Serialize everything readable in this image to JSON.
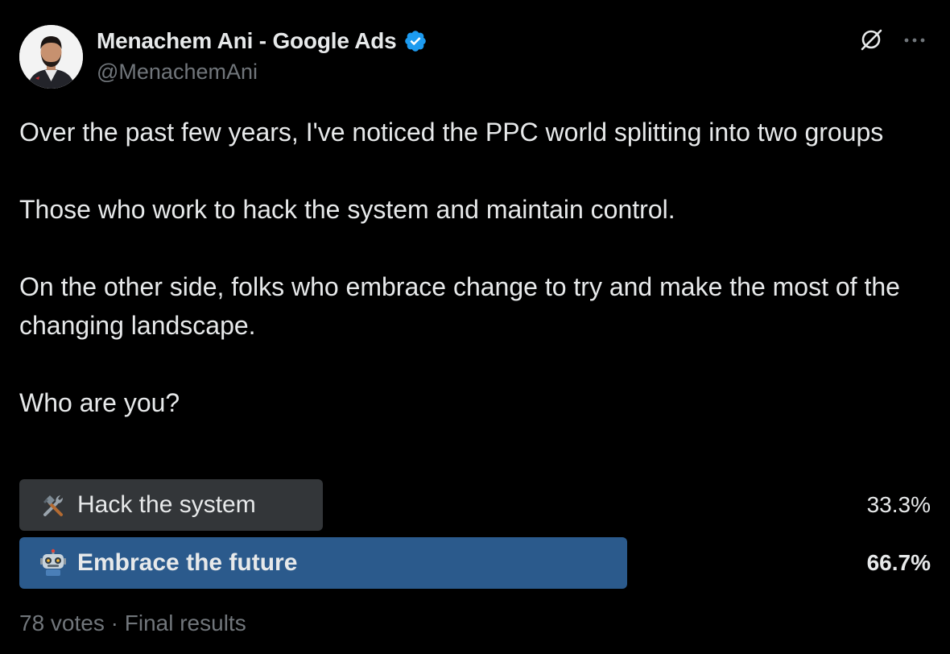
{
  "author": {
    "name": "Menachem Ani - Google Ads",
    "handle": "@MenachemAni",
    "verified": true,
    "verified_color": "#1d9bf0"
  },
  "header_actions": {
    "grok_icon": "grok-icon",
    "more_icon": "more-horizontal-icon"
  },
  "tweet": {
    "paragraphs": [
      "Over the past few years, I've noticed the PPC world splitting into two groups",
      "Those who work to hack the system and maintain control.",
      "On the other side, folks who embrace change to try and make the most of the changing landscape.",
      "Who are you?"
    ]
  },
  "poll": {
    "options": [
      {
        "emoji_icon": "hammer-and-wrench-icon",
        "label": "Hack the system",
        "percent_text": "33.3%",
        "percent": 33.3,
        "bar_color": "#333639",
        "winner": false
      },
      {
        "emoji_icon": "robot-icon",
        "label": "Embrace the future",
        "percent_text": "66.7%",
        "percent": 66.7,
        "bar_color": "#2b5a8c",
        "winner": true
      }
    ],
    "votes": "78 votes",
    "separator": "·",
    "status": "Final results"
  },
  "colors": {
    "background": "#000000",
    "text_primary": "#e7e9ea",
    "text_secondary": "#71767b"
  }
}
